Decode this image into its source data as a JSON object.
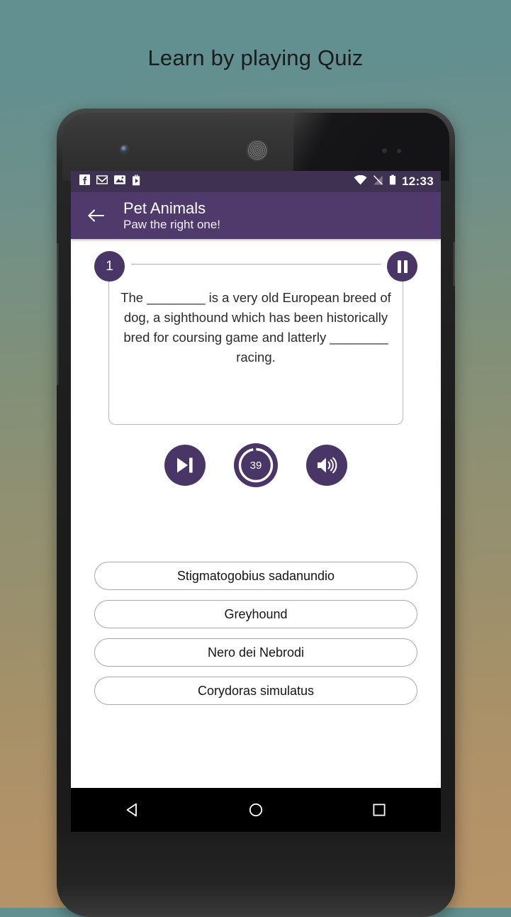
{
  "page": {
    "headline": "Learn by playing Quiz",
    "background_top_color": "#628f90",
    "background_bottom_color": "#b79468"
  },
  "device": {
    "icons": {
      "front_camera": "front-camera",
      "earpiece": "earpiece-speaker",
      "proximity_sensor": "proximity-sensor"
    }
  },
  "statusbar": {
    "background_color": "#3e3152",
    "left_icons": [
      {
        "name": "facebook-icon",
        "label": "Facebook"
      },
      {
        "name": "gmail-icon",
        "label": "Gmail"
      },
      {
        "name": "photos-icon",
        "label": "Photos"
      },
      {
        "name": "play-store-icon",
        "label": "Play Store"
      }
    ],
    "right_icons": [
      {
        "name": "wifi-icon",
        "label": "Wi-Fi"
      },
      {
        "name": "no-signal-icon",
        "label": "No SIM"
      },
      {
        "name": "battery-icon",
        "label": "Battery"
      }
    ],
    "clock": "12:33"
  },
  "appbar": {
    "background_color": "#4f3a6b",
    "back_label": "Back",
    "title": "Pet Animals",
    "subtitle": "Paw the right one!"
  },
  "quiz": {
    "question_number": "1",
    "pause_label": "Pause",
    "question_text": "The ________ is a very old European breed of dog, a sighthound which has been historically bred for coursing game and latterly ________ racing.",
    "accent_color": "#4a3666",
    "controls": {
      "skip_label": "Skip",
      "timer_value": "39",
      "timer_max": "40",
      "sound_label": "Sound"
    },
    "options": [
      {
        "label": "Stigmatogobius sadanundio"
      },
      {
        "label": "Greyhound"
      },
      {
        "label": "Nero dei Nebrodi"
      },
      {
        "label": "Corydoras simulatus"
      }
    ]
  },
  "navbar": {
    "back": "Back",
    "home": "Home",
    "recents": "Recents"
  }
}
